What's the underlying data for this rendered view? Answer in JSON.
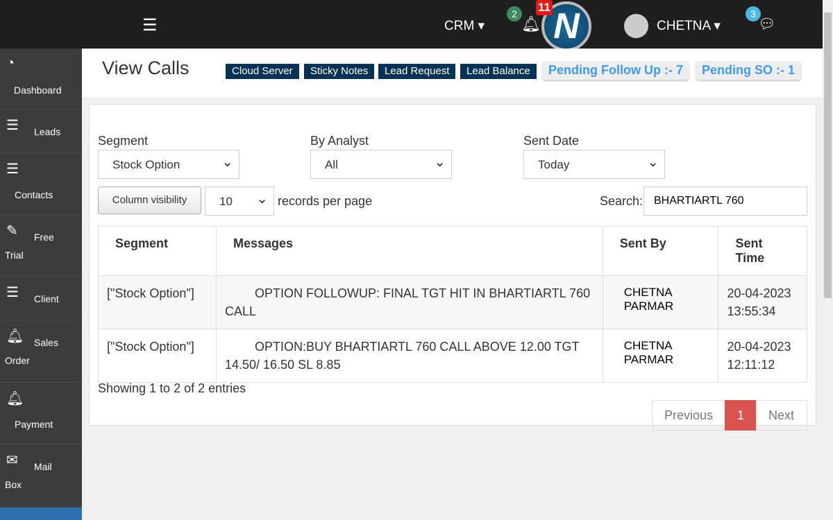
{
  "header": {
    "crm": "CRM ▾",
    "notif_count": "2",
    "alert_count": "11",
    "logo": "N",
    "user": "CHETNA ▾",
    "chat_count": "3"
  },
  "sidebar": [
    {
      "icon": "dashboard-icon",
      "glyph": "◔",
      "l1": "",
      "l2": "Dashboard"
    },
    {
      "icon": "table-icon",
      "glyph": "☰",
      "l1": "Leads",
      "l2": ""
    },
    {
      "icon": "table-icon",
      "glyph": "☰",
      "l1": "",
      "l2": "Contacts"
    },
    {
      "icon": "edit-icon",
      "glyph": "✎",
      "l1": "Free",
      "l2": "Trial"
    },
    {
      "icon": "table-icon",
      "glyph": "☰",
      "l1": "Client",
      "l2": ""
    },
    {
      "icon": "bell-icon",
      "glyph": "🔔︎",
      "l1": "Sales",
      "l2": "Order"
    },
    {
      "icon": "bell-icon",
      "glyph": "🔔︎",
      "l1": "",
      "l2": "Payment"
    },
    {
      "icon": "mail-icon",
      "glyph": "✉",
      "l1": "Mail",
      "l2": "Box"
    }
  ],
  "page": {
    "title": "View Calls",
    "quick": [
      "Cloud Server",
      "Sticky Notes",
      "Lead Request",
      "Lead Balance"
    ],
    "pending_followup": "Pending Follow Up :- 7",
    "pending_so": "Pending SO :- 1"
  },
  "filters": {
    "segment_label": "Segment",
    "segment": "Stock Option",
    "analyst_label": "By Analyst",
    "analyst": "All",
    "date_label": "Sent Date",
    "date": "Today"
  },
  "controls": {
    "colvis": "Column visibility",
    "per_page": "10",
    "per_page_label": "records per page",
    "search_label": "Search:",
    "search": "BHARTIARTL 760"
  },
  "table": {
    "headers": [
      "Segment",
      "Messages",
      "Sent By",
      "Sent Time"
    ],
    "rows": [
      [
        "[\"Stock Option\"]",
        "OPTION FOLLOWUP: FINAL TGT HIT IN BHARTIARTL 760 CALL",
        "CHETNA PARMAR",
        "20-04-2023 13:55:34"
      ],
      [
        "[\"Stock Option\"]",
        "OPTION:BUY BHARTIARTL 760 CALL ABOVE 12.00 TGT 14.50/ 16.50 SL 8.85",
        "CHETNA PARMAR",
        "20-04-2023 12:11:12"
      ]
    ]
  },
  "footer": {
    "info": "Showing 1 to 2 of 2 entries",
    "prev": "Previous",
    "page": "1",
    "next": "Next"
  }
}
